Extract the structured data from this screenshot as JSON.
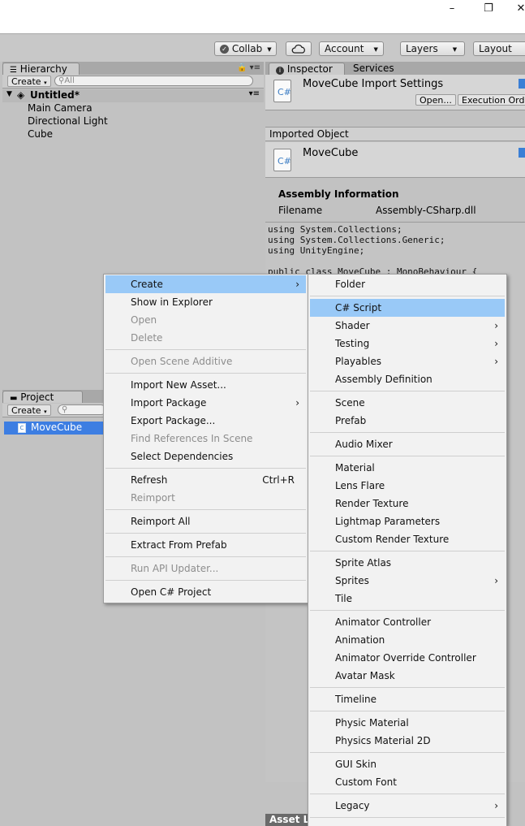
{
  "window": {
    "minimize": "–",
    "maximize": "❐",
    "close": "✕"
  },
  "toolbar": {
    "collab": "Collab",
    "account": "Account",
    "layers": "Layers",
    "layout": "Layout"
  },
  "hierarchy": {
    "tab": "Hierarchy",
    "create": "Create",
    "search_placeholder": "All",
    "scene": "Untitled*",
    "items": [
      "Main Camera",
      "Directional Light",
      "Cube"
    ]
  },
  "project": {
    "tab": "Project",
    "create": "Create",
    "selected_item": "MoveCube"
  },
  "inspector": {
    "tabs": [
      "Inspector",
      "Services"
    ],
    "title": "MoveCube Import Settings",
    "open_button": "Open...",
    "execution_order_button": "Execution Orde",
    "imported_object_label": "Imported Object",
    "object_name": "MoveCube",
    "assembly_info_title": "Assembly Information",
    "filename_label": "Filename",
    "filename_value": "Assembly-CSharp.dll",
    "code_lines": [
      "using System.Collections;",
      "using System.Collections.Generic;",
      "using UnityEngine;",
      "",
      "public class MoveCube : MonoBehaviour {"
    ],
    "bottom_label": "Asset L"
  },
  "context_menu": {
    "items": [
      {
        "label": "Create",
        "submenu": "›"
      },
      {
        "label": "Show in Explorer"
      },
      {
        "label": "Open"
      },
      {
        "label": "Delete"
      },
      {
        "label": "Open Scene Additive"
      },
      {
        "label": "Import New Asset..."
      },
      {
        "label": "Import Package",
        "submenu": "›"
      },
      {
        "label": "Export Package..."
      },
      {
        "label": "Find References In Scene"
      },
      {
        "label": "Select Dependencies"
      },
      {
        "label": "Refresh",
        "shortcut": "Ctrl+R"
      },
      {
        "label": "Reimport"
      },
      {
        "label": "Reimport All"
      },
      {
        "label": "Extract From Prefab"
      },
      {
        "label": "Run API Updater..."
      },
      {
        "label": "Open C# Project"
      }
    ]
  },
  "create_submenu": {
    "arrow": "›",
    "items": [
      "Folder",
      "C# Script",
      "Shader",
      "Testing",
      "Playables",
      "Assembly Definition",
      "Scene",
      "Prefab",
      "Audio Mixer",
      "Material",
      "Lens Flare",
      "Render Texture",
      "Lightmap Parameters",
      "Custom Render Texture",
      "Sprite Atlas",
      "Sprites",
      "Tile",
      "Animator Controller",
      "Animation",
      "Animator Override Controller",
      "Avatar Mask",
      "Timeline",
      "Physic Material",
      "Physics Material 2D",
      "GUI Skin",
      "Custom Font",
      "Legacy"
    ]
  },
  "icons": {
    "file_icon_text": "C#",
    "scene_icon": "unity-logo-icon"
  },
  "colors": {
    "highlight": "#99c9f7",
    "selection": "#3d7ee2"
  }
}
